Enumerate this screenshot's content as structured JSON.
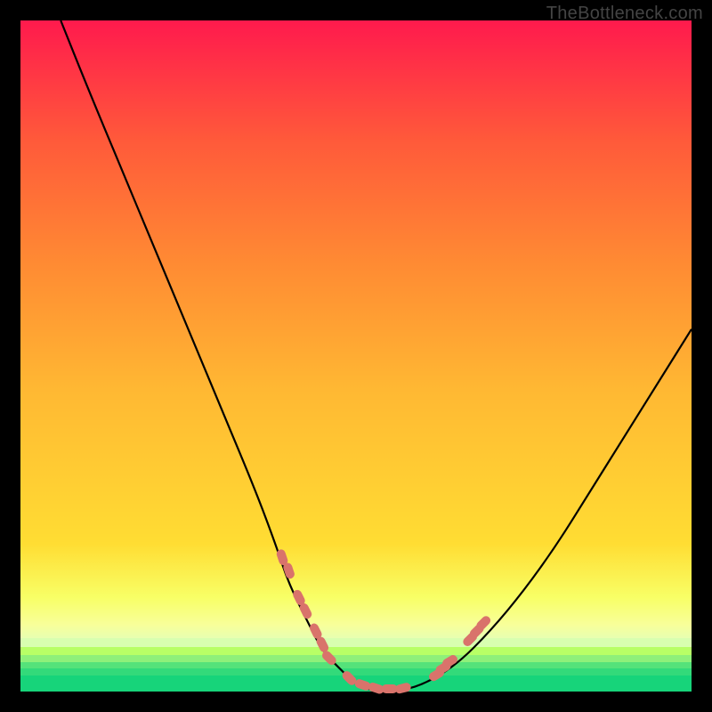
{
  "watermark": "TheBottleneck.com",
  "colors": {
    "top": "#ff1a4d",
    "mid": "#ffdd33",
    "green_top": "#b8ff66",
    "green_mid": "#55e27a",
    "green_bottom": "#17d47a",
    "curve": "#000000",
    "marker": "#d9736b"
  },
  "chart_data": {
    "type": "line",
    "title": "",
    "xlabel": "",
    "ylabel": "",
    "xlim": [
      0,
      100
    ],
    "ylim": [
      0,
      100
    ],
    "series": [
      {
        "name": "bottleneck-curve",
        "x": [
          6,
          10,
          15,
          20,
          25,
          30,
          35,
          38,
          40,
          43,
          45,
          48,
          50,
          53,
          56,
          60,
          65,
          70,
          75,
          80,
          85,
          90,
          95,
          100
        ],
        "y": [
          100,
          90,
          78,
          66,
          54,
          42,
          30,
          22,
          16,
          10,
          6,
          3,
          1,
          0,
          0,
          1,
          4,
          9,
          15,
          22,
          30,
          38,
          46,
          54
        ]
      }
    ],
    "markers": [
      {
        "x": 39,
        "y": 20
      },
      {
        "x": 40,
        "y": 18
      },
      {
        "x": 41.5,
        "y": 14
      },
      {
        "x": 42.5,
        "y": 12
      },
      {
        "x": 44,
        "y": 9
      },
      {
        "x": 45,
        "y": 7
      },
      {
        "x": 46,
        "y": 5
      },
      {
        "x": 49,
        "y": 2
      },
      {
        "x": 51,
        "y": 1
      },
      {
        "x": 53,
        "y": 0.5
      },
      {
        "x": 55,
        "y": 0.4
      },
      {
        "x": 57,
        "y": 0.5
      },
      {
        "x": 62,
        "y": 2.5
      },
      {
        "x": 63,
        "y": 3.5
      },
      {
        "x": 64,
        "y": 4.5
      },
      {
        "x": 67,
        "y": 7.8
      },
      {
        "x": 68,
        "y": 9
      },
      {
        "x": 69,
        "y": 10.2
      }
    ]
  }
}
